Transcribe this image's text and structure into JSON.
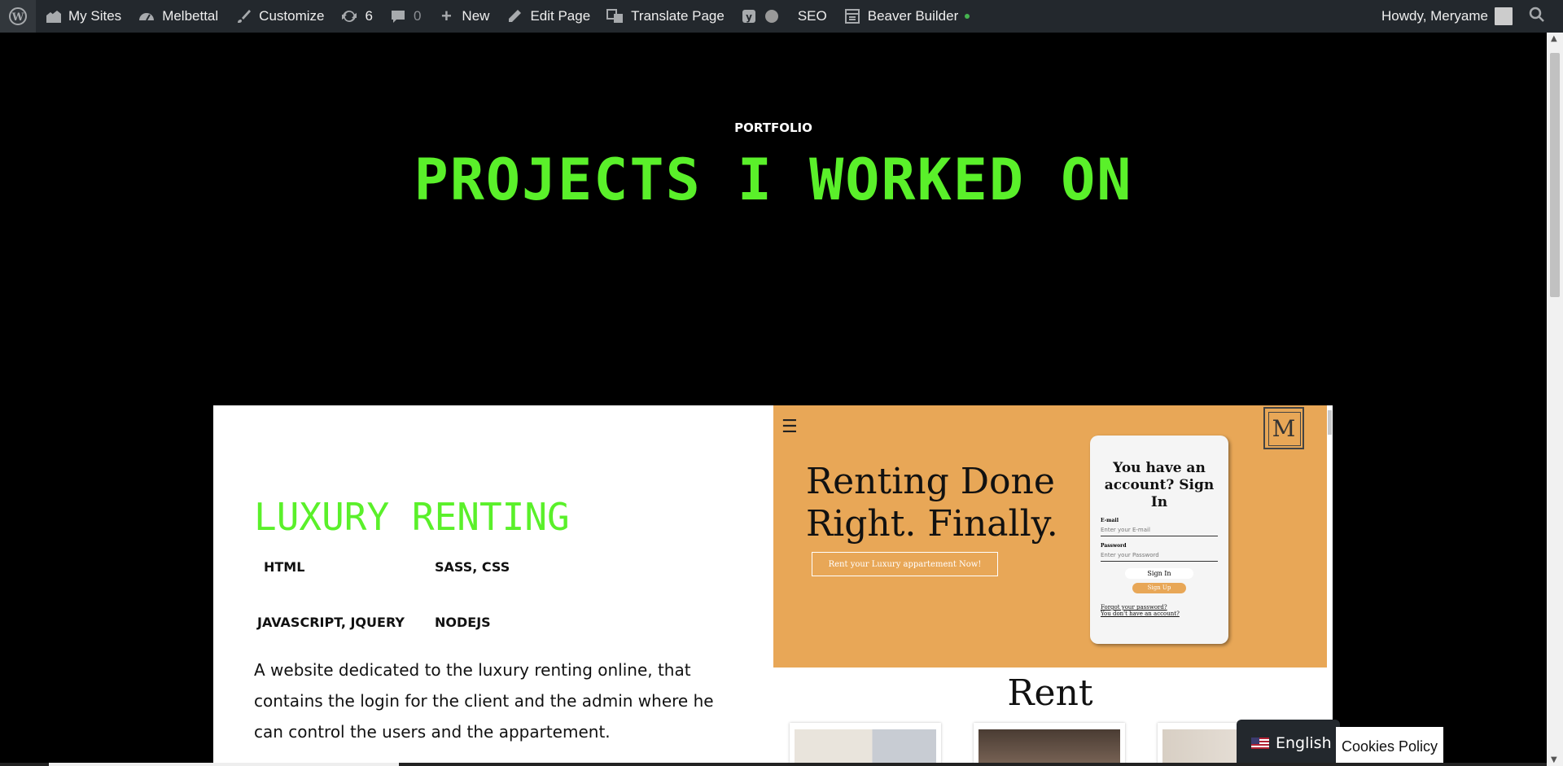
{
  "adminbar": {
    "my_sites": "My Sites",
    "site_name": "Melbettal",
    "customize": "Customize",
    "updates_count": "6",
    "comments_count": "0",
    "new": "New",
    "edit_page": "Edit Page",
    "translate_page": "Translate Page",
    "seo": "SEO",
    "beaver_builder": "Beaver Builder",
    "howdy": "Howdy, Meryame"
  },
  "hero": {
    "kicker": "PORTFOLIO",
    "title": "PROJECTS I WORKED ON"
  },
  "project": {
    "title": "LUXURY RENTING",
    "tags": [
      "HTML",
      "SASS, CSS",
      "JAVASCRIPT, JQUERY",
      "NODEJS"
    ],
    "description": "A website dedicated to the luxury renting online, that contains the login for the client and the admin where he can control the users and the appartement."
  },
  "preview": {
    "logo_letter": "M",
    "headline": "Renting Done Right. Finally.",
    "cta": "Rent your Luxury appartement Now!",
    "login_title": "You have an account? Sign In",
    "email_label": "E-mail",
    "email_placeholder": "Enter your E-mail",
    "password_label": "Password",
    "password_placeholder": "Enter your Password",
    "sign_in": "Sign In",
    "sign_up": "Sign Up",
    "forgot": "Forgot your password?",
    "no_account": "You don't have an account?",
    "section_title": "Rent",
    "accent_color": "#e8a757"
  },
  "language": {
    "current": "English"
  },
  "cookies": {
    "label": "Cookies Policy"
  },
  "colors": {
    "accent_green": "#5af02a",
    "admin_bar": "#23282d"
  }
}
